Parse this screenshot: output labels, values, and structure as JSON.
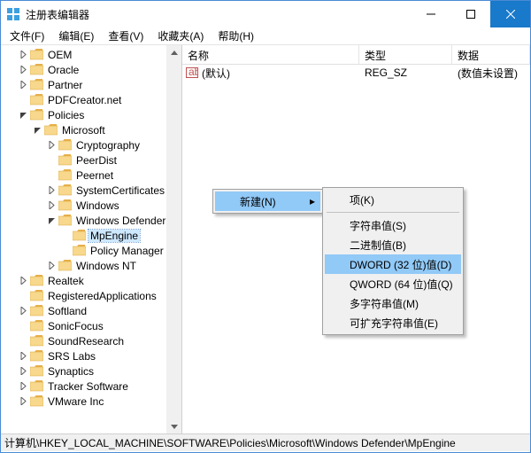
{
  "window": {
    "title": "注册表编辑器"
  },
  "menu": {
    "file": "文件(F)",
    "edit": "编辑(E)",
    "view": "查看(V)",
    "fav": "收藏夹(A)",
    "help": "帮助(H)"
  },
  "tree": {
    "items": [
      {
        "d": 1,
        "tw": "r",
        "name": "OEM"
      },
      {
        "d": 1,
        "tw": "r",
        "name": "Oracle"
      },
      {
        "d": 1,
        "tw": "r",
        "name": "Partner"
      },
      {
        "d": 1,
        "tw": "",
        "name": "PDFCreator.net"
      },
      {
        "d": 1,
        "tw": "d",
        "name": "Policies"
      },
      {
        "d": 2,
        "tw": "d",
        "name": "Microsoft"
      },
      {
        "d": 3,
        "tw": "r",
        "name": "Cryptography"
      },
      {
        "d": 3,
        "tw": "",
        "name": "PeerDist"
      },
      {
        "d": 3,
        "tw": "",
        "name": "Peernet"
      },
      {
        "d": 3,
        "tw": "r",
        "name": "SystemCertificates"
      },
      {
        "d": 3,
        "tw": "r",
        "name": "Windows"
      },
      {
        "d": 3,
        "tw": "d",
        "name": "Windows Defender"
      },
      {
        "d": 4,
        "tw": "",
        "name": "MpEngine",
        "sel": true
      },
      {
        "d": 4,
        "tw": "",
        "name": "Policy Manager"
      },
      {
        "d": 3,
        "tw": "r",
        "name": "Windows NT"
      },
      {
        "d": 1,
        "tw": "r",
        "name": "Realtek"
      },
      {
        "d": 1,
        "tw": "",
        "name": "RegisteredApplications"
      },
      {
        "d": 1,
        "tw": "r",
        "name": "Softland"
      },
      {
        "d": 1,
        "tw": "",
        "name": "SonicFocus"
      },
      {
        "d": 1,
        "tw": "",
        "name": "SoundResearch"
      },
      {
        "d": 1,
        "tw": "r",
        "name": "SRS Labs"
      },
      {
        "d": 1,
        "tw": "r",
        "name": "Synaptics"
      },
      {
        "d": 1,
        "tw": "r",
        "name": "Tracker Software"
      },
      {
        "d": 1,
        "tw": "r",
        "name": "VMware  Inc"
      }
    ]
  },
  "columns": {
    "name": "名称",
    "type": "类型",
    "data": "数据"
  },
  "rows": [
    {
      "name": "(默认)",
      "type": "REG_SZ",
      "data": "(数值未设置)"
    }
  ],
  "context": {
    "parent": {
      "new": "新建(N)"
    },
    "sub": {
      "key": "项(K)",
      "string": "字符串值(S)",
      "binary": "二进制值(B)",
      "dword": "DWORD (32 位)值(D)",
      "qword": "QWORD (64 位)值(Q)",
      "multi": "多字符串值(M)",
      "expand": "可扩充字符串值(E)"
    }
  },
  "status": {
    "path": "计算机\\HKEY_LOCAL_MACHINE\\SOFTWARE\\Policies\\Microsoft\\Windows Defender\\MpEngine"
  }
}
